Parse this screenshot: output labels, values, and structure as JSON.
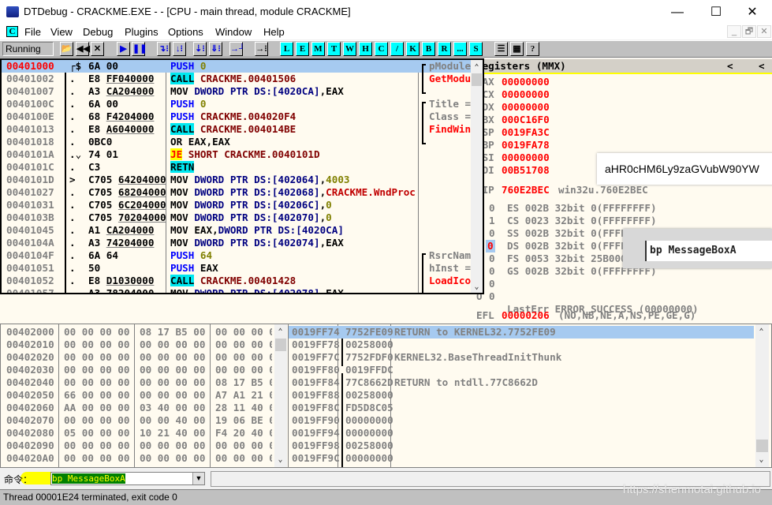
{
  "window": {
    "title": "DTDebug - CRACKME.EXE - - [CPU - main thread, module CRACKME]",
    "minimize": "—",
    "maximize": "☐",
    "close": "✕"
  },
  "menu": {
    "mdi_icon": "C",
    "items": [
      "File",
      "View",
      "Debug",
      "Plugins",
      "Options",
      "Window",
      "Help"
    ],
    "mdi_buttons": [
      "_",
      "🗗",
      "✕"
    ]
  },
  "toolbar": {
    "status": "Running",
    "buttons": [
      {
        "name": "open",
        "label": "📂"
      },
      {
        "name": "restart",
        "label": "◀◀"
      },
      {
        "name": "close",
        "label": "✕"
      },
      {
        "name": "run",
        "label": "▶"
      },
      {
        "name": "pause",
        "label": "❚❚"
      },
      {
        "name": "step-into",
        "label": "↴⁝"
      },
      {
        "name": "step-over",
        "label": "↓⁝"
      },
      {
        "name": "trace-into",
        "label": "⇣⁝"
      },
      {
        "name": "trace-over",
        "label": "⇓⁝"
      },
      {
        "name": "execute-till-return",
        "label": "→┘"
      },
      {
        "name": "go-to",
        "label": "→⁝"
      },
      {
        "name": "log",
        "label": "L"
      },
      {
        "name": "executables",
        "label": "E"
      },
      {
        "name": "memory",
        "label": "M"
      },
      {
        "name": "threads",
        "label": "T"
      },
      {
        "name": "windows",
        "label": "W"
      },
      {
        "name": "handles",
        "label": "H"
      },
      {
        "name": "cpu",
        "label": "C"
      },
      {
        "name": "patches",
        "label": "/"
      },
      {
        "name": "call-stack",
        "label": "K"
      },
      {
        "name": "breakpoints",
        "label": "B"
      },
      {
        "name": "references",
        "label": "R"
      },
      {
        "name": "run-trace",
        "label": "..."
      },
      {
        "name": "source",
        "label": "S"
      },
      {
        "name": "list",
        "label": "☰"
      },
      {
        "name": "colors",
        "label": "▦"
      },
      {
        "name": "help",
        "label": "?"
      }
    ]
  },
  "disasm": {
    "rows": [
      {
        "addr": "00401000",
        "mark": "┌$",
        "hex": "6A 00",
        "ul": "",
        "mn": "PUSH",
        "mk": "push",
        "ops": [
          [
            " 0",
            "num"
          ]
        ],
        "cmt": "pModule",
        "ck": "arg",
        "eip": true
      },
      {
        "addr": "00401002",
        "mark": ".",
        "hex": "E8 ",
        "ul": "FF040000",
        "mn": "CALL",
        "mk": "call",
        "ops": [
          [
            " CRACKME.00401506",
            "sym"
          ]
        ],
        "cmt": "GetModu",
        "ck": "api"
      },
      {
        "addr": "00401007",
        "mark": ".",
        "hex": "A3 ",
        "ul": "CA204000",
        "mn": "MOV",
        "mk": "plain",
        "ops": [
          [
            " DWORD PTR DS:[4020CA]",
            "kw"
          ],
          [
            ",EAX",
            "plain"
          ]
        ],
        "cmt": "",
        "ck": ""
      },
      {
        "addr": "0040100C",
        "mark": ".",
        "hex": "6A 00",
        "ul": "",
        "mn": "PUSH",
        "mk": "push",
        "ops": [
          [
            " 0",
            "num"
          ]
        ],
        "cmt": "Title =",
        "ck": "arg"
      },
      {
        "addr": "0040100E",
        "mark": ".",
        "hex": "68 ",
        "ul": "F4204000",
        "mn": "PUSH",
        "mk": "push",
        "ops": [
          [
            " CRACKME.004020F4",
            "sym"
          ]
        ],
        "cmt": "Class =",
        "ck": "arg"
      },
      {
        "addr": "00401013",
        "mark": ".",
        "hex": "E8 ",
        "ul": "A6040000",
        "mn": "CALL",
        "mk": "call",
        "ops": [
          [
            " CRACKME.004014BE",
            "sym"
          ]
        ],
        "cmt": "FindWin",
        "ck": "api"
      },
      {
        "addr": "00401018",
        "mark": ".",
        "hex": "0BC0",
        "ul": "",
        "mn": "OR",
        "mk": "plain",
        "ops": [
          [
            " EAX,EAX",
            "plain"
          ]
        ],
        "cmt": "",
        "ck": ""
      },
      {
        "addr": "0040101A",
        "mark": ".⌄",
        "hex": "74 01",
        "ul": "",
        "mn": "JE",
        "mk": "je",
        "ops": [
          [
            " SHORT CRACKME.0040101D",
            "sym"
          ]
        ],
        "cmt": "",
        "ck": ""
      },
      {
        "addr": "0040101C",
        "mark": ".",
        "hex": "C3",
        "ul": "",
        "mn": "RETN",
        "mk": "ret",
        "ops": [],
        "cmt": "",
        "ck": ""
      },
      {
        "addr": "0040101D",
        "mark": ">",
        "hex": "C705 ",
        "ul": "64204000",
        "mn": "MOV",
        "mk": "plain",
        "ops": [
          [
            " DWORD PTR DS:[402064]",
            "kw"
          ],
          [
            ",",
            "plain"
          ],
          [
            "4003",
            "num"
          ]
        ],
        "cmt": "",
        "ck": ""
      },
      {
        "addr": "00401027",
        "mark": ".",
        "hex": "C705 ",
        "ul": "68204000",
        "mn": "MOV",
        "mk": "plain",
        "ops": [
          [
            " DWORD PTR DS:[402068]",
            "kw"
          ],
          [
            ",",
            "plain"
          ],
          [
            "CRACKME.WndProc",
            "sym2"
          ]
        ],
        "cmt": "",
        "ck": ""
      },
      {
        "addr": "00401031",
        "mark": ".",
        "hex": "C705 ",
        "ul": "6C204000",
        "mn": "MOV",
        "mk": "plain",
        "ops": [
          [
            " DWORD PTR DS:[40206C]",
            "kw"
          ],
          [
            ",",
            "plain"
          ],
          [
            "0",
            "num"
          ]
        ],
        "cmt": "",
        "ck": ""
      },
      {
        "addr": "0040103B",
        "mark": ".",
        "hex": "C705 ",
        "ul": "70204000",
        "mn": "MOV",
        "mk": "plain",
        "ops": [
          [
            " DWORD PTR DS:[402070]",
            "kw"
          ],
          [
            ",",
            "plain"
          ],
          [
            "0",
            "num"
          ]
        ],
        "cmt": "",
        "ck": ""
      },
      {
        "addr": "00401045",
        "mark": ".",
        "hex": "A1 ",
        "ul": "CA204000",
        "mn": "MOV",
        "mk": "plain",
        "ops": [
          [
            " EAX,",
            "plain"
          ],
          [
            "DWORD PTR DS:[4020CA]",
            "kw"
          ]
        ],
        "cmt": "",
        "ck": ""
      },
      {
        "addr": "0040104A",
        "mark": ".",
        "hex": "A3 ",
        "ul": "74204000",
        "mn": "MOV",
        "mk": "plain",
        "ops": [
          [
            " DWORD PTR DS:[402074]",
            "kw"
          ],
          [
            ",EAX",
            "plain"
          ]
        ],
        "cmt": "",
        "ck": ""
      },
      {
        "addr": "0040104F",
        "mark": ".",
        "hex": "6A 64",
        "ul": "",
        "mn": "PUSH",
        "mk": "push",
        "ops": [
          [
            " 64",
            "num"
          ]
        ],
        "cmt": "RsrcNam",
        "ck": "arg"
      },
      {
        "addr": "00401051",
        "mark": ".",
        "hex": "50",
        "ul": "",
        "mn": "PUSH",
        "mk": "push",
        "ops": [
          [
            " EAX",
            "plain"
          ]
        ],
        "cmt": "hInst =",
        "ck": "arg"
      },
      {
        "addr": "00401052",
        "mark": ".",
        "hex": "E8 ",
        "ul": "D1030000",
        "mn": "CALL",
        "mk": "call",
        "ops": [
          [
            " CRACKME.00401428",
            "sym"
          ]
        ],
        "cmt": "LoadIco",
        "ck": "api"
      },
      {
        "addr": "00401057",
        "mark": ".",
        "hex": "A3 ",
        "ul": "78204000",
        "mn": "MOV",
        "mk": "plain",
        "ops": [
          [
            " DWORD PTR DS:[402078]",
            "kw"
          ],
          [
            ",EAX",
            "plain"
          ]
        ],
        "cmt": "",
        "ck": ""
      }
    ]
  },
  "registers": {
    "title": "Registers (MMX)",
    "nav_left": "<",
    "nav_right": "<",
    "gp": [
      [
        "EAX",
        "00000000"
      ],
      [
        "ECX",
        "00000000"
      ],
      [
        "EDX",
        "00000000"
      ],
      [
        "EBX",
        "000C16F0"
      ],
      [
        "ESP",
        "0019FA3C"
      ],
      [
        "EBP",
        "0019FA78"
      ],
      [
        "ESI",
        "00000000"
      ],
      [
        "EDI",
        "00B51708"
      ]
    ],
    "eip": {
      "name": "EIP",
      "value": "760E2BEC",
      "desc": "win32u.760E2BEC"
    },
    "flags": [
      [
        "C",
        "0",
        "ES 002B 32bit 0(FFFFFFFF)"
      ],
      [
        "P",
        "1",
        "CS 0023 32bit 0(FFFFFFFF)"
      ],
      [
        "A",
        "0",
        "SS 002B 32bit 0(FFFFFFFF)"
      ],
      [
        "Z",
        "0",
        "DS 002B 32bit 0(FFFFFFFF)"
      ],
      [
        "S",
        "0",
        "FS 0053 32bit 25B000(FFF)"
      ],
      [
        "T",
        "0",
        "GS 002B 32bit 0(FFFFFFFF)"
      ],
      [
        "D",
        "0",
        ""
      ],
      [
        "O",
        "0",
        "LastErr ERROR_SUCCESS (00000000)"
      ]
    ],
    "efl": {
      "name": "EFL",
      "value": "00000206",
      "desc": "(NO,NB,NE,A,NS,PE,GE,G)"
    }
  },
  "tooltip": {
    "text": "aHR0cHM6Ly9zaGVubW90YW"
  },
  "overlay": {
    "text": "bp MessageBoxA"
  },
  "dump": {
    "rows": [
      [
        "00402000",
        "00 00 00 00",
        "08 17 B5 00",
        "00 00 00 00"
      ],
      [
        "00402010",
        "00 00 00 00",
        "00 00 00 00",
        "00 00 00 00"
      ],
      [
        "00402020",
        "00 00 00 00",
        "00 00 00 00",
        "00 00 00 00"
      ],
      [
        "00402030",
        "00 00 00 00",
        "00 00 00 00",
        "00 00 00 00"
      ],
      [
        "00402040",
        "00 00 00 00",
        "00 00 00 00",
        "08 17 B5 00"
      ],
      [
        "00402050",
        "66 00 00 00",
        "00 00 00 00",
        "A7 A1 21 00"
      ],
      [
        "00402060",
        "AA 00 00 00",
        "03 40 00 00",
        "28 11 40 00"
      ],
      [
        "00402070",
        "00 00 00 00",
        "00 00 40 00",
        "19 06 BE 00"
      ],
      [
        "00402080",
        "05 00 00 00",
        "10 21 40 00",
        "F4 20 40 00"
      ],
      [
        "00402090",
        "00 00 00 00",
        "00 00 00 00",
        "00 00 00 00"
      ],
      [
        "004020A0",
        "00 00 00 00",
        "00 00 00 00",
        "00 00 00 00"
      ]
    ]
  },
  "stack": {
    "rows": [
      [
        "0019FF74",
        "7752FE09",
        "RETURN to KERNEL32.7752FE09"
      ],
      [
        "0019FF78",
        "00258000",
        ""
      ],
      [
        "0019FF7C",
        "7752FDF0",
        "KERNEL32.BaseThreadInitThunk"
      ],
      [
        "0019FF80",
        "0019FFDC",
        ""
      ],
      [
        "0019FF84",
        "77C8662D",
        "RETURN to ntdll.77C8662D"
      ],
      [
        "0019FF88",
        "00258000",
        ""
      ],
      [
        "0019FF8C",
        "FD5D8C05",
        ""
      ],
      [
        "0019FF90",
        "00000000",
        ""
      ],
      [
        "0019FF94",
        "00000000",
        ""
      ],
      [
        "0019FF98",
        "00258000",
        ""
      ],
      [
        "0019FF9C",
        "00000000",
        ""
      ]
    ]
  },
  "command": {
    "label": "命令：",
    "value": "bp MessageBoxA",
    "dropdown": "▼"
  },
  "status": {
    "text": "Thread 00001E24 terminated, exit code 0"
  },
  "watermark": "https://shenmotai.github.io",
  "colors": {
    "accent_cyan": "#00ffff",
    "selection": "#a6caf0",
    "panel_bg": "#fffbf0",
    "register_changed": "#ff0000"
  }
}
